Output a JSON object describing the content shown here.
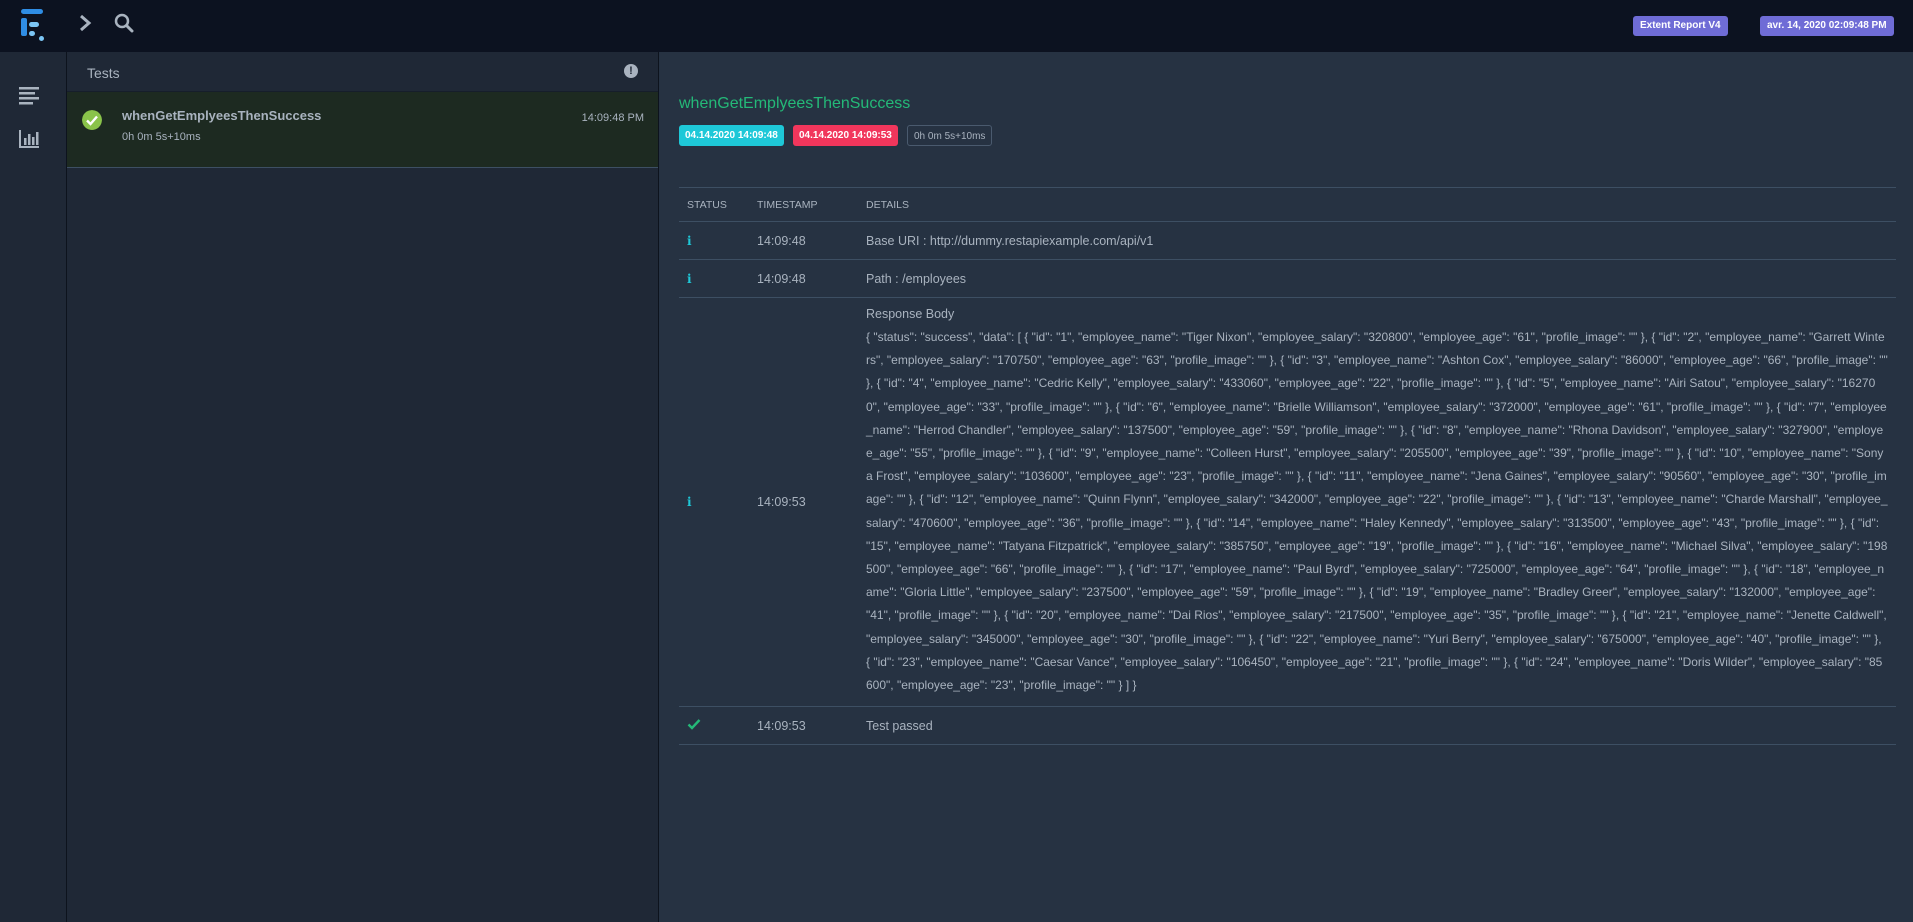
{
  "app": {
    "report_badge": "Extent Report V4",
    "date_badge": "avr. 14, 2020 02:09:48 PM",
    "colors": {
      "accent": "#6f6cd6",
      "pass": "#24b978",
      "info": "#1ec8d8",
      "fail": "#f1365c",
      "pass_icon": "#8ac34a"
    }
  },
  "nav": {
    "icons": [
      "logo",
      "chevron-right-icon",
      "search-icon"
    ],
    "rail_icons": [
      "list-icon",
      "dashboard-chart-icon"
    ]
  },
  "tests_panel": {
    "title": "Tests",
    "items": [
      {
        "name": "whenGetEmplyeesThenSuccess",
        "duration": "0h 0m 5s+10ms",
        "time": "14:09:48 PM",
        "status": "pass"
      }
    ]
  },
  "detail": {
    "title": "whenGetEmplyeesThenSuccess",
    "start": "04.14.2020 14:09:48",
    "end": "04.14.2020 14:09:53",
    "duration": "0h 0m 5s+10ms",
    "columns": [
      "STATUS",
      "TIMESTAMP",
      "DETAILS"
    ],
    "rows": [
      {
        "status": "info",
        "timestamp": "14:09:48",
        "details": "Base URI : http://dummy.restapiexample.com/api/v1"
      },
      {
        "status": "info",
        "timestamp": "14:09:48",
        "details": "Path : /employees"
      },
      {
        "status": "info",
        "timestamp": "14:09:53",
        "label": "Response Body",
        "details": "{ \"status\": \"success\", \"data\": [ { \"id\": \"1\", \"employee_name\": \"Tiger Nixon\", \"employee_salary\": \"320800\", \"employee_age\": \"61\", \"profile_image\": \"\" }, { \"id\": \"2\", \"employee_name\": \"Garrett Winters\", \"employee_salary\": \"170750\", \"employee_age\": \"63\", \"profile_image\": \"\" }, { \"id\": \"3\", \"employee_name\": \"Ashton Cox\", \"employee_salary\": \"86000\", \"employee_age\": \"66\", \"profile_image\": \"\" }, { \"id\": \"4\", \"employee_name\": \"Cedric Kelly\", \"employee_salary\": \"433060\", \"employee_age\": \"22\", \"profile_image\": \"\" }, { \"id\": \"5\", \"employee_name\": \"Airi Satou\", \"employee_salary\": \"162700\", \"employee_age\": \"33\", \"profile_image\": \"\" }, { \"id\": \"6\", \"employee_name\": \"Brielle Williamson\", \"employee_salary\": \"372000\", \"employee_age\": \"61\", \"profile_image\": \"\" }, { \"id\": \"7\", \"employee_name\": \"Herrod Chandler\", \"employee_salary\": \"137500\", \"employee_age\": \"59\", \"profile_image\": \"\" }, { \"id\": \"8\", \"employee_name\": \"Rhona Davidson\", \"employee_salary\": \"327900\", \"employee_age\": \"55\", \"profile_image\": \"\" }, { \"id\": \"9\", \"employee_name\": \"Colleen Hurst\", \"employee_salary\": \"205500\", \"employee_age\": \"39\", \"profile_image\": \"\" }, { \"id\": \"10\", \"employee_name\": \"Sonya Frost\", \"employee_salary\": \"103600\", \"employee_age\": \"23\", \"profile_image\": \"\" }, { \"id\": \"11\", \"employee_name\": \"Jena Gaines\", \"employee_salary\": \"90560\", \"employee_age\": \"30\", \"profile_image\": \"\" }, { \"id\": \"12\", \"employee_name\": \"Quinn Flynn\", \"employee_salary\": \"342000\", \"employee_age\": \"22\", \"profile_image\": \"\" }, { \"id\": \"13\", \"employee_name\": \"Charde Marshall\", \"employee_salary\": \"470600\", \"employee_age\": \"36\", \"profile_image\": \"\" }, { \"id\": \"14\", \"employee_name\": \"Haley Kennedy\", \"employee_salary\": \"313500\", \"employee_age\": \"43\", \"profile_image\": \"\" }, { \"id\": \"15\", \"employee_name\": \"Tatyana Fitzpatrick\", \"employee_salary\": \"385750\", \"employee_age\": \"19\", \"profile_image\": \"\" }, { \"id\": \"16\", \"employee_name\": \"Michael Silva\", \"employee_salary\": \"198500\", \"employee_age\": \"66\", \"profile_image\": \"\" }, { \"id\": \"17\", \"employee_name\": \"Paul Byrd\", \"employee_salary\": \"725000\", \"employee_age\": \"64\", \"profile_image\": \"\" }, { \"id\": \"18\", \"employee_name\": \"Gloria Little\", \"employee_salary\": \"237500\", \"employee_age\": \"59\", \"profile_image\": \"\" }, { \"id\": \"19\", \"employee_name\": \"Bradley Greer\", \"employee_salary\": \"132000\", \"employee_age\": \"41\", \"profile_image\": \"\" }, { \"id\": \"20\", \"employee_name\": \"Dai Rios\", \"employee_salary\": \"217500\", \"employee_age\": \"35\", \"profile_image\": \"\" }, { \"id\": \"21\", \"employee_name\": \"Jenette Caldwell\", \"employee_salary\": \"345000\", \"employee_age\": \"30\", \"profile_image\": \"\" }, { \"id\": \"22\", \"employee_name\": \"Yuri Berry\", \"employee_salary\": \"675000\", \"employee_age\": \"40\", \"profile_image\": \"\" }, { \"id\": \"23\", \"employee_name\": \"Caesar Vance\", \"employee_salary\": \"106450\", \"employee_age\": \"21\", \"profile_image\": \"\" }, { \"id\": \"24\", \"employee_name\": \"Doris Wilder\", \"employee_salary\": \"85600\", \"employee_age\": \"23\", \"profile_image\": \"\" } ] }"
      },
      {
        "status": "pass",
        "timestamp": "14:09:53",
        "details": "Test passed"
      }
    ]
  }
}
